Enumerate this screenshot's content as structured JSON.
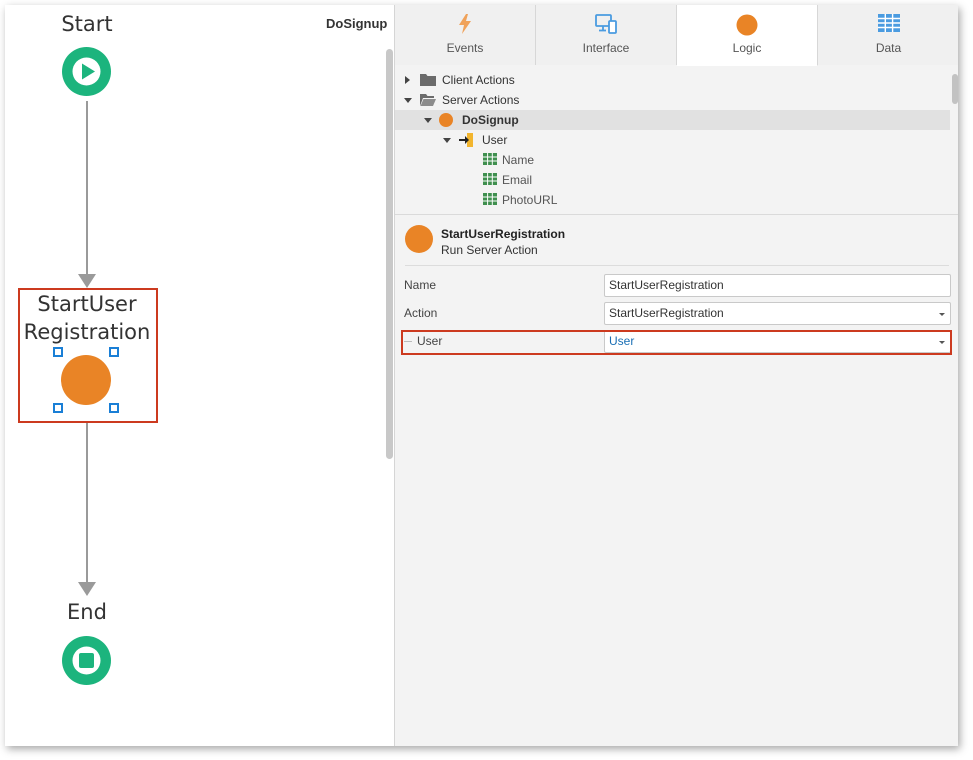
{
  "canvas": {
    "title": "DoSignup",
    "nodes": {
      "start": "Start",
      "action_line1": "StartUser",
      "action_line2": "Registration",
      "end": "End"
    }
  },
  "tabs": [
    {
      "label": "Events",
      "icon": "lightning-icon",
      "active": false
    },
    {
      "label": "Interface",
      "icon": "devices-icon",
      "active": false
    },
    {
      "label": "Logic",
      "icon": "orange-circle-icon",
      "active": true
    },
    {
      "label": "Data",
      "icon": "grid-icon",
      "active": false
    }
  ],
  "tree": {
    "client_actions": "Client Actions",
    "server_actions": "Server Actions",
    "do_signup": "DoSignup",
    "user": "User",
    "name": "Name",
    "email": "Email",
    "photo_url": "PhotoURL"
  },
  "properties": {
    "title": "StartUserRegistration",
    "subtitle": "Run Server Action",
    "name_label": "Name",
    "name_value": "StartUserRegistration",
    "action_label": "Action",
    "action_value": "StartUserRegistration",
    "user_label": "User",
    "user_value": "User"
  },
  "colors": {
    "start_end": "#1cb47d",
    "action": "#e98426",
    "highlight": "#cc3a1f",
    "selection_handle": "#1a7fd6",
    "link": "#1a6fb5"
  }
}
